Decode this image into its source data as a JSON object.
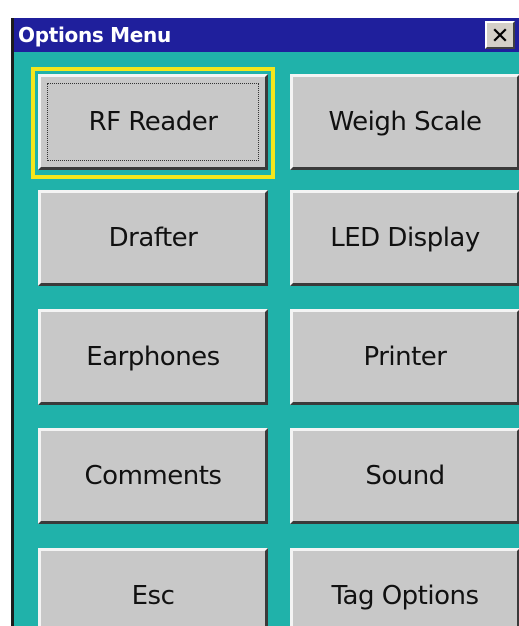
{
  "window": {
    "title": "Options Menu",
    "close_label": "×"
  },
  "buttons": [
    {
      "label": "RF Reader",
      "focused": true
    },
    {
      "label": "Weigh Scale"
    },
    {
      "label": "Drafter"
    },
    {
      "label": "LED Display"
    },
    {
      "label": "Earphones"
    },
    {
      "label": "Printer"
    },
    {
      "label": "Comments"
    },
    {
      "label": "Sound"
    },
    {
      "label": "Esc"
    },
    {
      "label": "Tag Options"
    }
  ],
  "colors": {
    "titlebar": "#1f1f9c",
    "background": "#20b2aa",
    "button_face": "#c8c8c8",
    "focus_ring": "#f5e61c"
  }
}
